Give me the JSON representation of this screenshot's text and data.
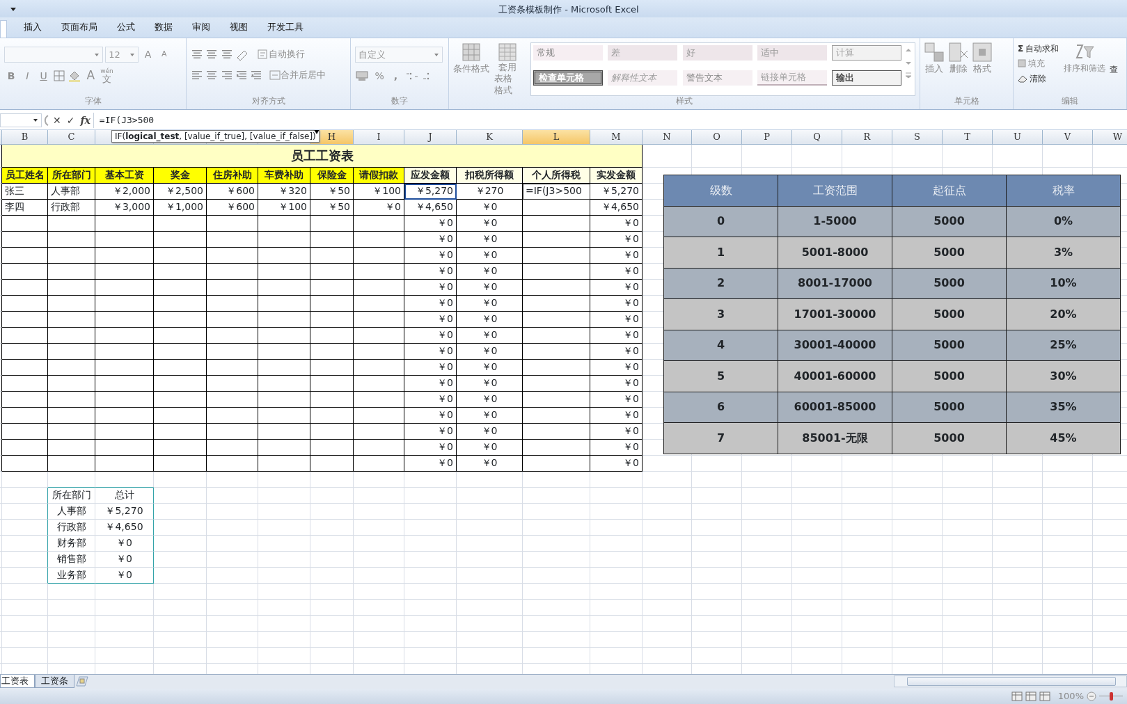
{
  "window": {
    "title": "工资条模板制作 - Microsoft Excel"
  },
  "ribbon_tabs": [
    {
      "label": "插入"
    },
    {
      "label": "页面布局"
    },
    {
      "label": "公式"
    },
    {
      "label": "数据"
    },
    {
      "label": "审阅"
    },
    {
      "label": "视图"
    },
    {
      "label": "开发工具"
    }
  ],
  "ribbon": {
    "font": {
      "size": "12",
      "grow": "A",
      "shrink": "A",
      "bold": "B",
      "italic": "I",
      "underline": "U",
      "color_letter": "A",
      "phonetic_top": "wén",
      "phonetic_bottom": "文",
      "label": "字体"
    },
    "alignment": {
      "wrap": "自动换行",
      "merge": "合并后居中",
      "label": "对齐方式"
    },
    "number": {
      "format": "自定义",
      "percent": "%",
      "comma": ",",
      "label": "数字"
    },
    "styles": {
      "conditional": "条件格式",
      "table_format": [
        "套用",
        "表格格式"
      ],
      "label": "样式",
      "cell_styles": [
        {
          "label": "常规",
          "kind": "normal"
        },
        {
          "label": "差",
          "kind": "bad"
        },
        {
          "label": "好",
          "kind": "good"
        },
        {
          "label": "适中",
          "kind": "neutral"
        },
        {
          "label": "计算",
          "kind": "calc"
        },
        {
          "label": "检查单元格",
          "kind": "check"
        },
        {
          "label": "解释性文本",
          "kind": "explanatory"
        },
        {
          "label": "警告文本",
          "kind": "warning"
        },
        {
          "label": "链接单元格",
          "kind": "linked"
        },
        {
          "label": "输出",
          "kind": "output"
        }
      ]
    },
    "cells": {
      "buttons": [
        "插入",
        "删除",
        "格式"
      ],
      "label": "单元格"
    },
    "editing": {
      "sigma": "Σ",
      "autosum": "自动求和",
      "fill": "填充",
      "clear": "清除",
      "sort": "排序和筛选",
      "cut": "查",
      "label": "编辑"
    }
  },
  "formula_bar": {
    "cancel": "✕",
    "enter": "✓",
    "fx": "fx",
    "formula": "=IF(J3>500",
    "tooltip": "IF(**logical_test**, [value_if_true], [value_if_false])"
  },
  "sheet": {
    "columns": [
      {},
      {
        "letter": "B",
        "highlighted": false
      },
      {
        "letter": "C",
        "highlighted": false
      },
      {},
      {},
      {},
      {},
      {
        "letter": "H",
        "highlighted": true
      },
      {
        "letter": "I",
        "highlighted": false
      },
      {
        "letter": "J",
        "highlighted": false
      },
      {
        "letter": "K",
        "highlighted": false
      },
      {
        "letter": "L",
        "highlighted": true
      },
      {
        "letter": "M",
        "highlighted": false
      },
      {
        "letter": "N",
        "highlighted": false
      },
      {
        "letter": "O",
        "highlighted": false
      },
      {
        "letter": "P",
        "highlighted": false
      },
      {
        "letter": "Q",
        "highlighted": false
      },
      {
        "letter": "R",
        "highlighted": false
      },
      {
        "letter": "S",
        "highlighted": false
      },
      {
        "letter": "T",
        "highlighted": false
      },
      {
        "letter": "U",
        "highlighted": false
      },
      {
        "letter": "V",
        "highlighted": false
      },
      {
        "letter": "W",
        "highlighted": false
      }
    ],
    "title": "员工工资表",
    "headers": [
      {
        "text": "员工姓名",
        "color": "#ffff00"
      },
      {
        "text": "所在部门",
        "color": "#ffff00"
      },
      {
        "text": "基本工资",
        "color": "#ffff00"
      },
      {
        "text": "奖金",
        "color": "#ffff00"
      },
      {
        "text": "住房补助",
        "color": "#ffff00"
      },
      {
        "text": "车费补助",
        "color": "#ffff00"
      },
      {
        "text": "保险金",
        "color": "#ffff00"
      },
      {
        "text": "请假扣款",
        "color": "#ffff00"
      },
      {
        "text": "应发金额",
        "color": "#ffffe6"
      },
      {
        "text": "扣税所得额",
        "color": "#ffffe6"
      },
      {
        "text": "个人所得税",
        "color": "#ffffe6"
      },
      {
        "text": "实发金额",
        "color": "#ffffe6"
      }
    ],
    "rows": [
      {
        "B": "张三",
        "C": "人事部",
        "D": "￥2,000",
        "E": "￥2,500",
        "F": "￥600",
        "G": "￥320",
        "H": "￥50",
        "I": "￥100",
        "J": {
          "text": "￥5,270",
          "selected": true
        },
        "K": "￥270",
        "L": {
          "text": "=IF(J3>500",
          "editing": true
        },
        "M": "￥5,270"
      },
      {
        "B": "李四",
        "C": "行政部",
        "D": "￥3,000",
        "E": "￥1,000",
        "F": "￥600",
        "G": "￥100",
        "H": "￥50",
        "I": "￥0",
        "J": "￥4,650",
        "K": "￥0",
        "M": "￥4,650"
      },
      {
        "J": "￥0",
        "K": "￥0",
        "M": "￥0"
      },
      {
        "J": "￥0",
        "K": "￥0",
        "M": "￥0"
      },
      {
        "J": "￥0",
        "K": "￥0",
        "M": "￥0"
      },
      {
        "J": "￥0",
        "K": "￥0",
        "M": "￥0"
      },
      {
        "J": "￥0",
        "K": "￥0",
        "M": "￥0"
      },
      {
        "J": "￥0",
        "K": "￥0",
        "M": "￥0"
      },
      {
        "J": "￥0",
        "K": "￥0",
        "M": "￥0"
      },
      {
        "J": "￥0",
        "K": "￥0",
        "M": "￥0"
      },
      {
        "J": "￥0",
        "K": "￥0",
        "M": "￥0"
      },
      {
        "J": "￥0",
        "K": "￥0",
        "M": "￥0"
      },
      {
        "J": "￥0",
        "K": "￥0",
        "M": "￥0"
      },
      {
        "J": "￥0",
        "K": "￥0",
        "M": "￥0"
      },
      {
        "J": "￥0",
        "K": "￥0",
        "M": "￥0"
      },
      {
        "J": "￥0",
        "K": "￥0",
        "M": "￥0"
      },
      {
        "J": "￥0",
        "K": "￥0",
        "M": "￥0"
      },
      {
        "J": "￥0",
        "K": "￥0",
        "M": "￥0"
      }
    ],
    "pivot": [
      {
        "C": "所在部门",
        "D": "总计"
      },
      {
        "C": "人事部",
        "D": "￥5,270"
      },
      {
        "C": "行政部",
        "D": "￥4,650"
      },
      {
        "C": "财务部",
        "D": "￥0"
      },
      {
        "C": "销售部",
        "D": "￥0"
      },
      {
        "C": "业务部",
        "D": "￥0"
      }
    ]
  },
  "tax_table": {
    "columns": [
      "级数",
      "工资范围",
      "起征点",
      "税率"
    ],
    "rows": [
      [
        "0",
        "1-5000",
        "5000",
        "0%"
      ],
      [
        "1",
        "5001-8000",
        "5000",
        "3%"
      ],
      [
        "2",
        "8001-17000",
        "5000",
        "10%"
      ],
      [
        "3",
        "17001-30000",
        "5000",
        "20%"
      ],
      [
        "4",
        "30001-40000",
        "5000",
        "25%"
      ],
      [
        "5",
        "40001-60000",
        "5000",
        "30%"
      ],
      [
        "6",
        "60001-85000",
        "5000",
        "35%"
      ],
      [
        "7",
        "85001-无限",
        "5000",
        "45%"
      ]
    ]
  },
  "sheet_tabs": [
    {
      "label": "工资表",
      "selected": true
    },
    {
      "label": "工资条",
      "selected": false
    }
  ],
  "status_bar": {
    "zoom": "100%",
    "zoom_slider": {
      "level": 0.5
    }
  }
}
